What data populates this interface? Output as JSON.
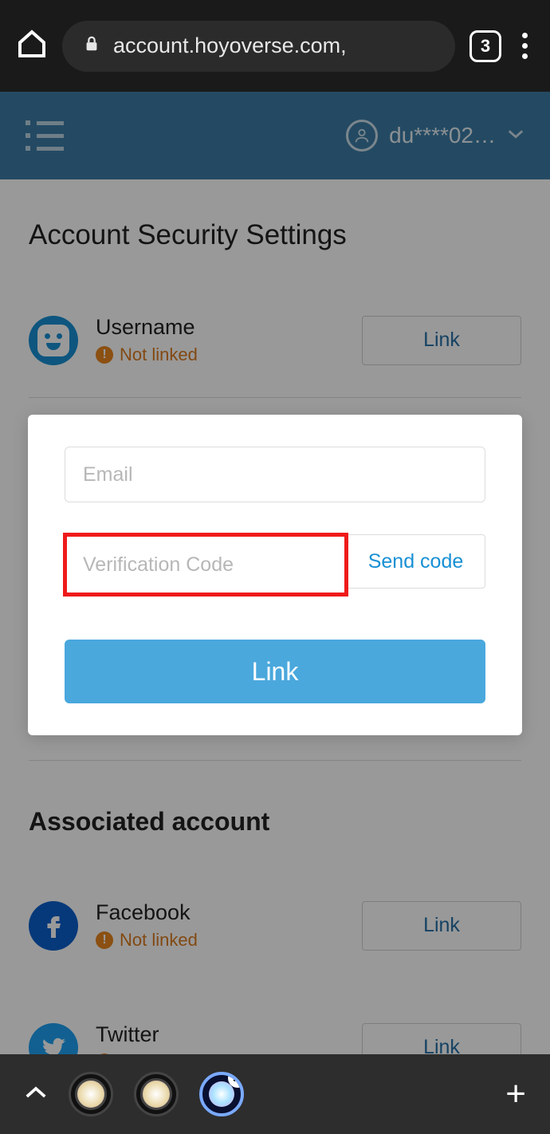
{
  "browser": {
    "url": "account.hoyoverse.com,",
    "tab_count": "3"
  },
  "header": {
    "username": "du****02…"
  },
  "page": {
    "title": "Account Security Settings",
    "associated_title": "Associated account"
  },
  "settings": {
    "username_label": "Username",
    "not_linked": "Not linked",
    "link_btn": "Link",
    "facebook": "Facebook",
    "twitter": "Twitter"
  },
  "modal": {
    "email_placeholder": "Email",
    "code_placeholder": "Verification Code",
    "send_code": "Send code",
    "submit": "Link"
  },
  "status_icon_char": "!"
}
